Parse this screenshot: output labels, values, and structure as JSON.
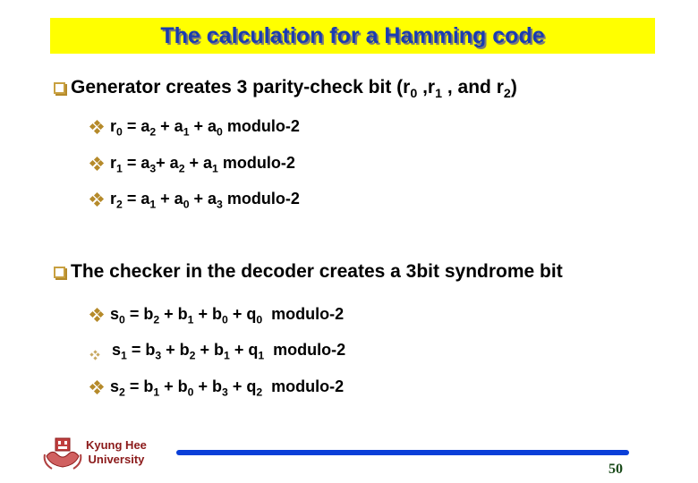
{
  "title": "The calculation for a Hamming code",
  "sections": [
    {
      "heading_parts": [
        "Generator creates 3 parity-check bit (r",
        "0",
        " ,r",
        "1",
        " , and r",
        "2",
        ")"
      ],
      "items": [
        {
          "parts": [
            "r",
            "0",
            " = a",
            "2",
            " + a",
            "1",
            " + a",
            "0",
            " modulo-2"
          ]
        },
        {
          "parts": [
            "r",
            "1",
            " = a",
            "3",
            "+ a",
            "2",
            " + a",
            "1",
            " modulo-2"
          ]
        },
        {
          "parts": [
            "r",
            "2",
            " = a",
            "1",
            " + a",
            "0",
            " + a",
            "3",
            " modulo-2"
          ]
        }
      ]
    },
    {
      "heading_parts": [
        "The checker in the decoder creates a 3bit syndrome bit"
      ],
      "items": [
        {
          "parts": [
            "s",
            "0",
            " = b",
            "2",
            " + b",
            "1",
            " + b",
            "0",
            " + q",
            "0",
            "  modulo-2"
          ]
        },
        {
          "parts": [
            "s",
            "1",
            " = b",
            "3",
            " + b",
            "2",
            " + b",
            "1",
            " + q",
            "1",
            "  modulo-2"
          ]
        },
        {
          "parts": [
            "s",
            "2",
            " = b",
            "1",
            " + b",
            "0",
            " + b",
            "3",
            " + q",
            "2",
            "  modulo-2"
          ]
        }
      ]
    }
  ],
  "footer": {
    "university_line1": "Kyung Hee",
    "university_line2": "University",
    "page_number": "50"
  },
  "colors": {
    "title_bg": "#ffff00",
    "title_text": "#1a3cb0",
    "bullet_gold": "#b58a2a",
    "university": "#8b1a1a",
    "footer_line": "#0a3fd8"
  }
}
